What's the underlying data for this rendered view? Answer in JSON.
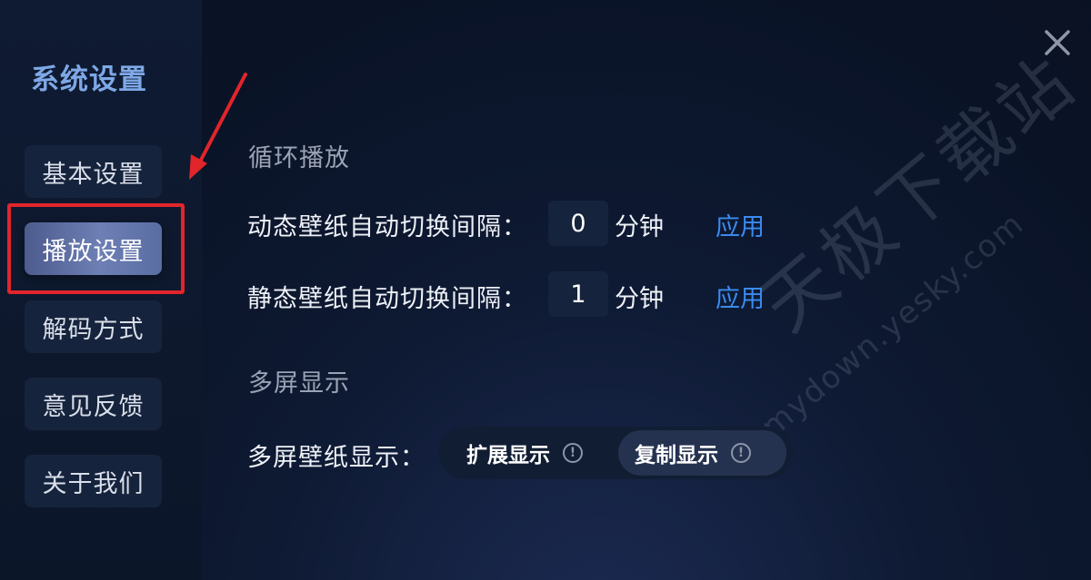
{
  "window": {
    "title": "系统设置"
  },
  "sidebar": {
    "items": [
      {
        "label": "基本设置"
      },
      {
        "label": "播放设置",
        "active": true
      },
      {
        "label": "解码方式"
      },
      {
        "label": "意见反馈"
      },
      {
        "label": "关于我们"
      }
    ]
  },
  "loop_playback": {
    "title": "循环播放",
    "dynamic": {
      "label": "动态壁纸自动切换间隔：",
      "value": "0",
      "unit": "分钟",
      "apply": "应用"
    },
    "static": {
      "label": "静态壁纸自动切换间隔：",
      "value": "1",
      "unit": "分钟",
      "apply": "应用"
    }
  },
  "multi_screen": {
    "title": "多屏显示",
    "label": "多屏壁纸显示：",
    "options": [
      {
        "label": "扩展显示",
        "selected": false
      },
      {
        "label": "复制显示",
        "selected": true
      }
    ],
    "info_glyph": "!"
  },
  "watermark": {
    "cn": "天极下载站",
    "en": "mydown.yesky.com"
  },
  "colors": {
    "background": "#0b1528",
    "sidebar": "#0f1b33",
    "accent_title": "#7ea8e6",
    "link": "#3a8bf0",
    "annotation": "#e2252b",
    "active_item": "#5a6da3"
  },
  "icons": {
    "close": "close-icon",
    "info": "info-circle-icon",
    "annotation_arrow": "arrow-icon"
  }
}
